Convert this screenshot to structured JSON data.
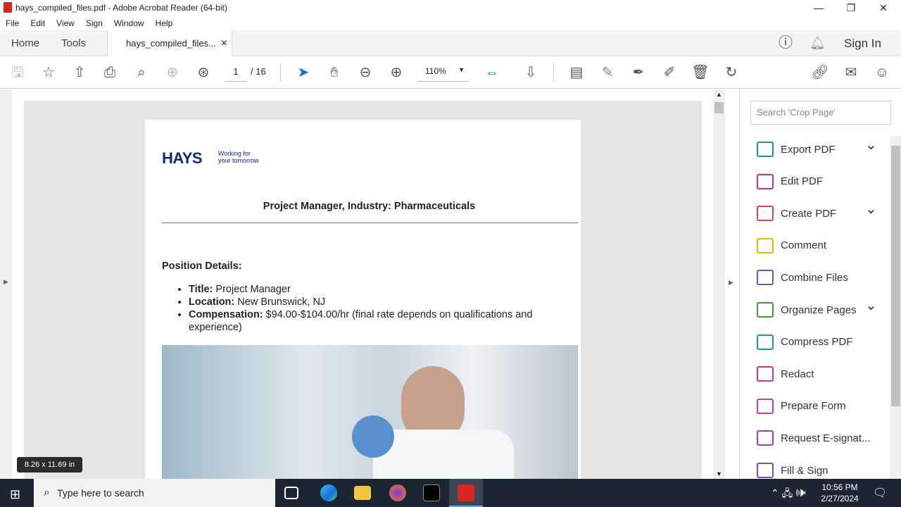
{
  "window": {
    "title": "hays_compiled_files.pdf - Adobe Acrobat Reader (64-bit)",
    "minimize": "—",
    "restore": "❐",
    "close": "✕"
  },
  "menu": [
    "File",
    "Edit",
    "View",
    "Sign",
    "Window",
    "Help"
  ],
  "tabs": {
    "home": "Home",
    "tools": "Tools",
    "doc": "hays_compiled_files...",
    "close": "×",
    "sign_in": "Sign In"
  },
  "toolbar": {
    "page_current": "1",
    "page_total": "/ 16",
    "zoom": "110%"
  },
  "document": {
    "logo": "HAYS",
    "tagline1": "Working for",
    "tagline2": "your tomorrow",
    "title": "Project Manager, Industry: Pharmaceuticals",
    "section": "Position Details:",
    "items": [
      {
        "label": "Title:",
        "value": " Project Manager"
      },
      {
        "label": "Location:",
        "value": " New Brunswick, NJ"
      },
      {
        "label": "Compensation:",
        "value": " $94.00-$104.00/hr (final rate depends on qualifications and experience)"
      }
    ]
  },
  "tooltip": "8.26 x 11.69 in",
  "right_panel": {
    "search_placeholder": "Search 'Crop Page'",
    "tools": [
      {
        "label": "Export PDF",
        "color": "#1a9c8c",
        "chevron": true
      },
      {
        "label": "Edit PDF",
        "color": "#d6336c",
        "chevron": false
      },
      {
        "label": "Create PDF",
        "color": "#e0473c",
        "chevron": true
      },
      {
        "label": "Comment",
        "color": "#e8b400",
        "chevron": false
      },
      {
        "label": "Combine Files",
        "color": "#5b5bd6",
        "chevron": false
      },
      {
        "label": "Organize Pages",
        "color": "#3aa02c",
        "chevron": true
      },
      {
        "label": "Compress PDF",
        "color": "#1a9c8c",
        "chevron": false
      },
      {
        "label": "Redact",
        "color": "#d6336c",
        "chevron": false
      },
      {
        "label": "Prepare Form",
        "color": "#c03ac0",
        "chevron": false
      },
      {
        "label": "Request E-signat...",
        "color": "#9b3ad6",
        "chevron": false
      },
      {
        "label": "Fill & Sign",
        "color": "#7a4ad6",
        "chevron": false
      }
    ]
  },
  "taskbar": {
    "search_placeholder": "Type here to search",
    "time": "10:56 PM",
    "date": "2/27/2024"
  }
}
